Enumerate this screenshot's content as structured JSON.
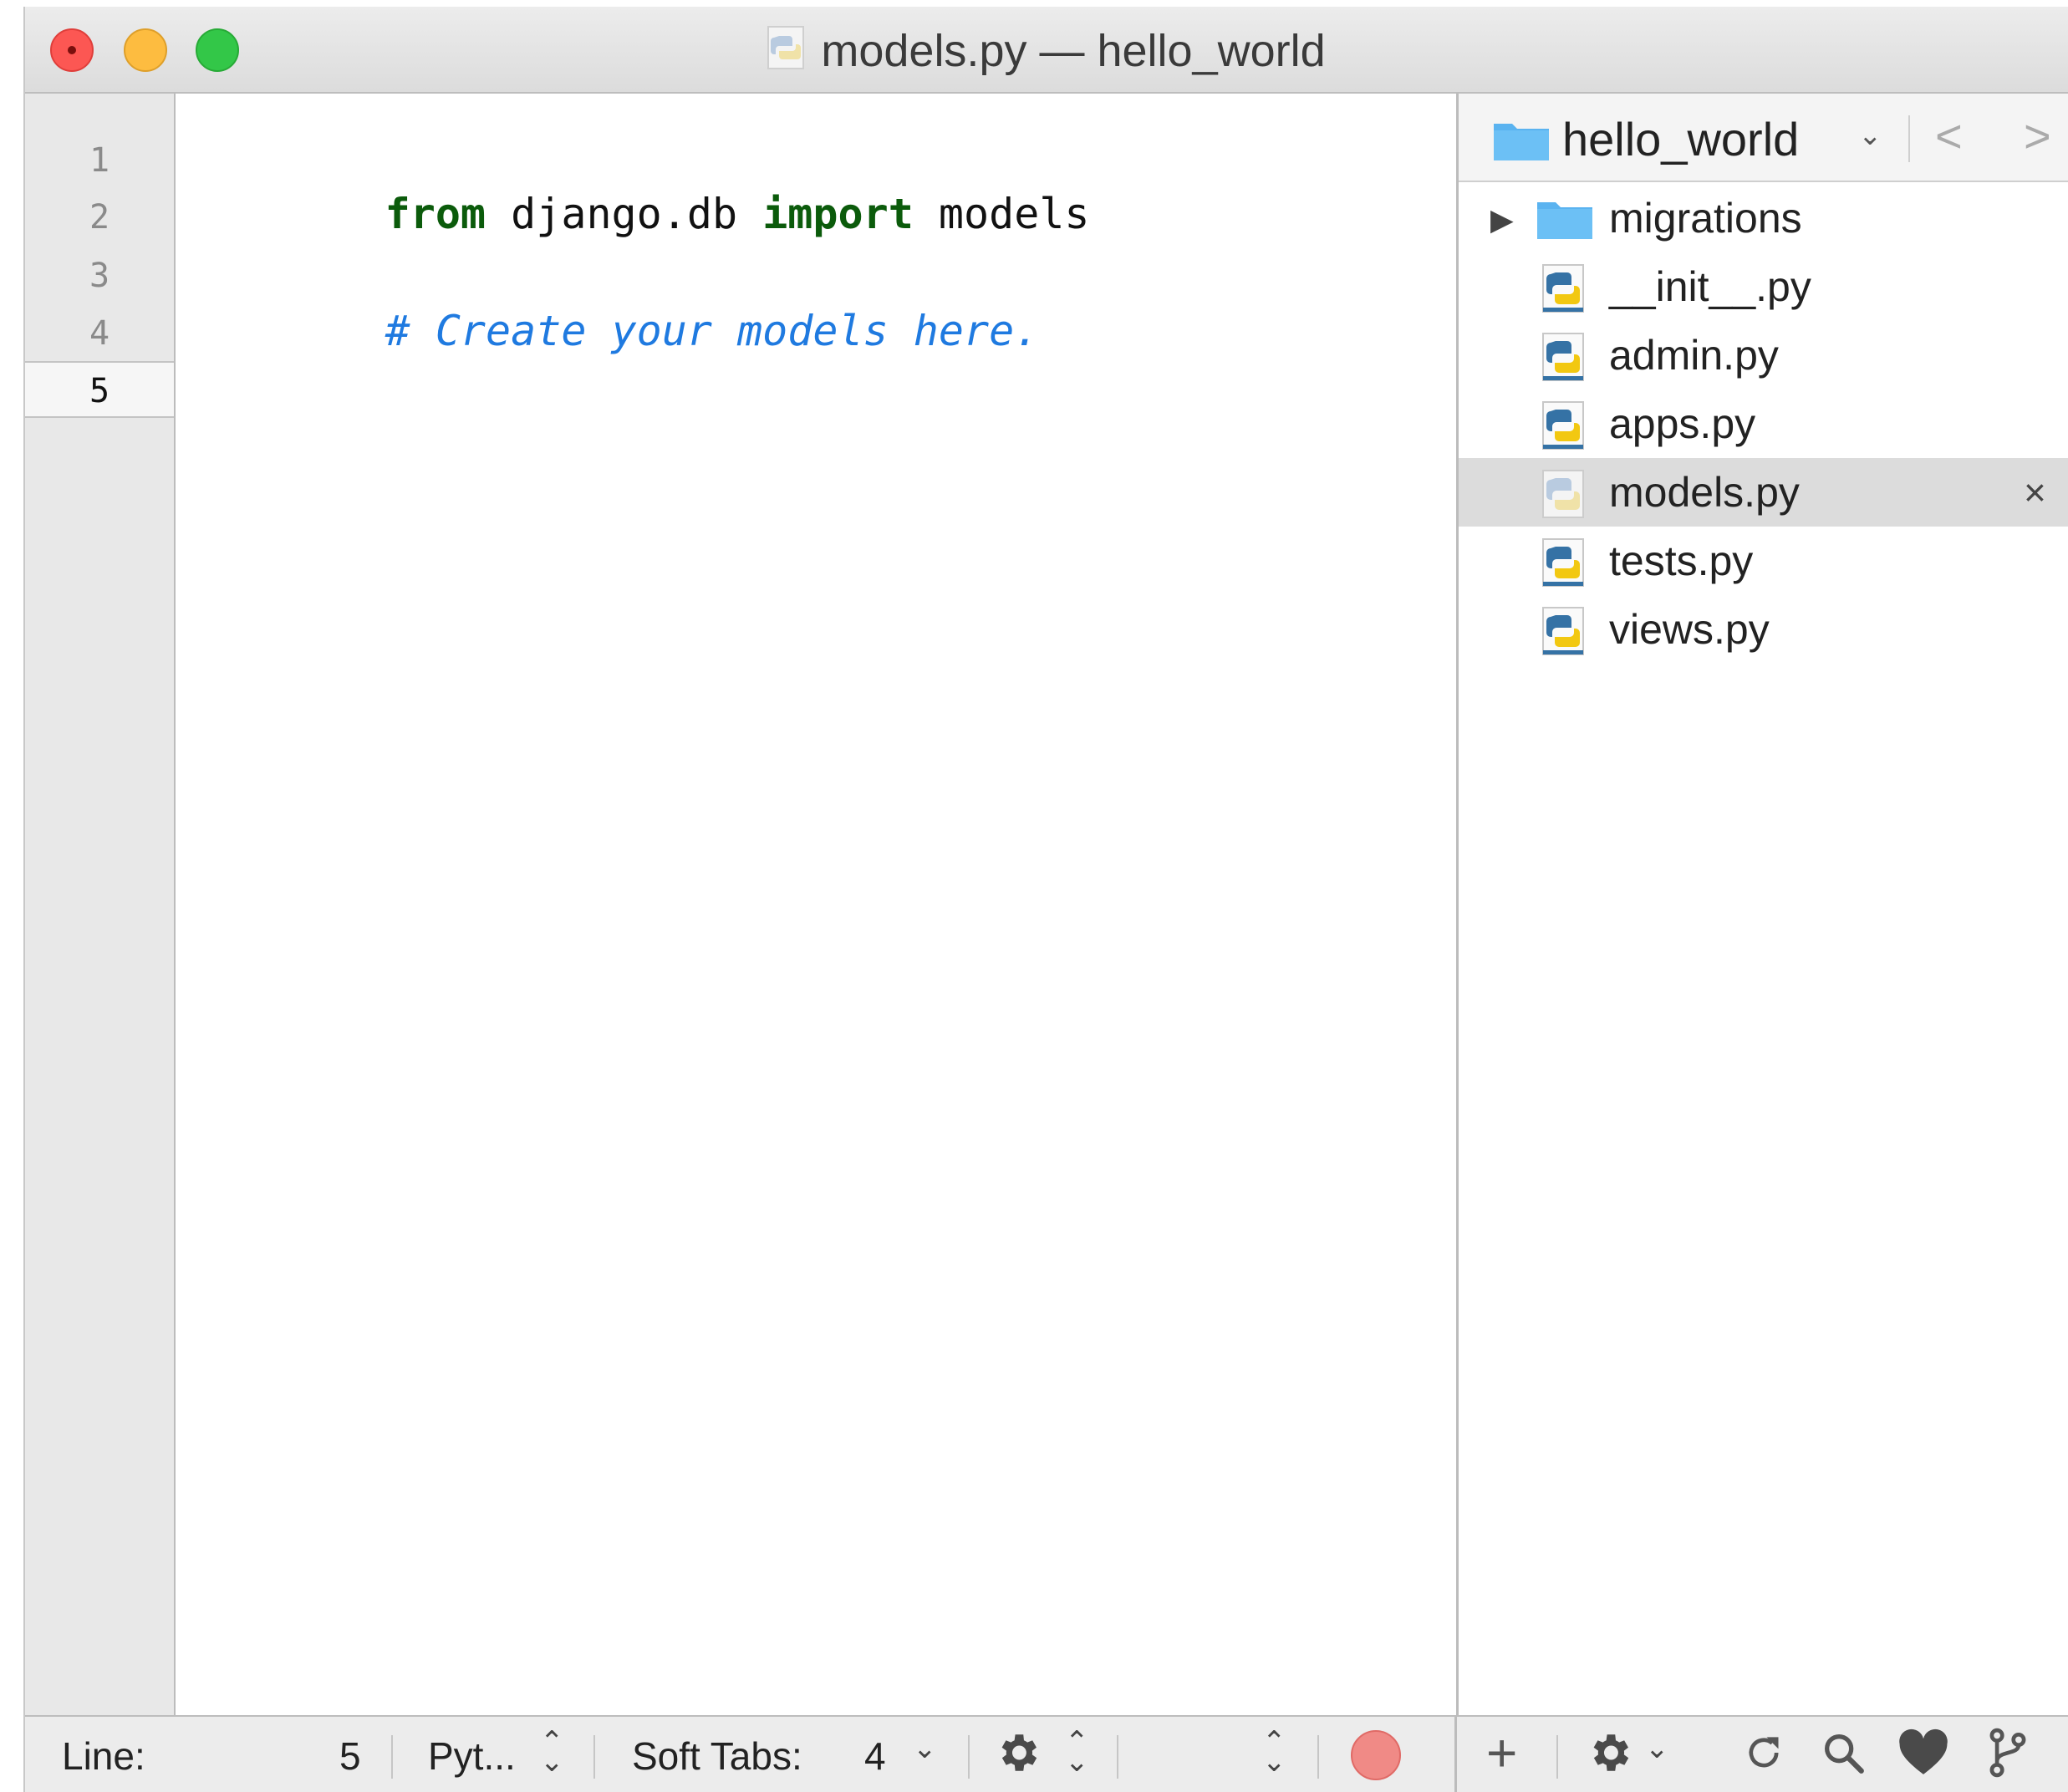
{
  "window": {
    "title": "models.py — hello_world"
  },
  "editor": {
    "line_numbers": [
      "1",
      "2",
      "3",
      "4",
      "5"
    ],
    "current_line": 5,
    "lines": {
      "line1": {
        "kw_from": "from",
        "module": " django.db ",
        "kw_import": "import",
        "name": " models"
      },
      "line3": {
        "comment": "# Create your models here."
      }
    }
  },
  "sidebar": {
    "project_name": "hello_world",
    "back_label": "<",
    "forward_label": ">",
    "chevron": "⌄",
    "tree": [
      {
        "label": "migrations",
        "type": "folder"
      },
      {
        "label": "__init__.py",
        "type": "python"
      },
      {
        "label": "admin.py",
        "type": "python"
      },
      {
        "label": "apps.py",
        "type": "python"
      },
      {
        "label": "models.py",
        "type": "python",
        "selected": true
      },
      {
        "label": "tests.py",
        "type": "python"
      },
      {
        "label": "views.py",
        "type": "python"
      }
    ],
    "close_glyph": "×"
  },
  "statusbar": {
    "line_label": "Line:",
    "line_value": "5",
    "language": "Pyt...",
    "soft_tabs_label": "Soft Tabs:",
    "soft_tabs_value": "4",
    "add_glyph": "+"
  },
  "colors": {
    "keyword": "#0b5b0b",
    "comment": "#1f7ae0",
    "selection": "#dcdcdc",
    "folder": "#5ab3f0"
  },
  "icons": {
    "close": "close-icon",
    "minimize": "minimize-icon",
    "maximize": "maximize-icon",
    "folder": "folder-icon",
    "python": "python-file-icon",
    "gear": "gear-icon",
    "refresh": "refresh-icon",
    "search": "search-icon",
    "heart": "heart-icon",
    "branch": "git-branch-icon"
  }
}
